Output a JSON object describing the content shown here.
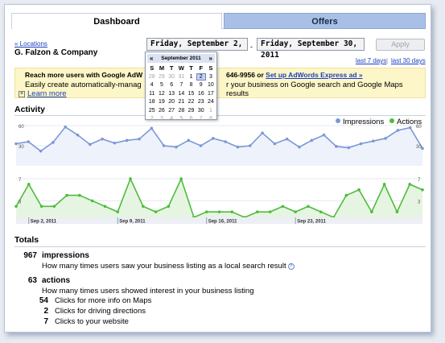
{
  "tabs": [
    {
      "label": "Dashboard"
    },
    {
      "label": "Offers"
    }
  ],
  "header": {
    "back_link": "« Locations",
    "company": "G. Falzon & Company"
  },
  "date_range": {
    "start": "Friday, September 2, 2011",
    "separator": "-",
    "end": "Friday, September 30, 2011",
    "apply_label": "Apply",
    "quick_links": [
      "last 7 days",
      "last 30 days"
    ],
    "quick_sep": "|"
  },
  "calendar": {
    "month": "September 2011",
    "prev": "«",
    "next": "»",
    "weekdays": [
      "S",
      "M",
      "T",
      "W",
      "T",
      "F",
      "S"
    ],
    "weeks": [
      [
        "28",
        "29",
        "30",
        "31",
        "1",
        "2",
        "3"
      ],
      [
        "4",
        "5",
        "6",
        "7",
        "8",
        "9",
        "10"
      ],
      [
        "11",
        "12",
        "13",
        "14",
        "15",
        "16",
        "17"
      ],
      [
        "18",
        "19",
        "20",
        "21",
        "22",
        "23",
        "24"
      ],
      [
        "25",
        "26",
        "27",
        "28",
        "29",
        "30",
        "1"
      ],
      [
        "2",
        "3",
        "4",
        "5",
        "6",
        "7",
        "8"
      ]
    ],
    "selected": "2"
  },
  "banner": {
    "line1_left": "Reach more users with Google AdW",
    "line1_right": "646-9956 or ",
    "line1_link": "Set up AdWords Express ad »",
    "line2_left": "Easily create automatically-manag",
    "line2_right": "r your business on Google search and Google Maps results",
    "learn_more": "Learn more",
    "plus": "+"
  },
  "activity": {
    "title": "Activity",
    "legend": [
      {
        "name": "Impressions",
        "color": "#7b98d6"
      },
      {
        "name": "Actions",
        "color": "#4fbb3c"
      }
    ]
  },
  "chart_data": [
    {
      "type": "line",
      "series": [
        {
          "name": "Impressions",
          "values": [
            33,
            36,
            22,
            35,
            58,
            46,
            32,
            40,
            34,
            38,
            40,
            56,
            30,
            28,
            38,
            30,
            41,
            36,
            28,
            30,
            49,
            33,
            40,
            28,
            38,
            46,
            29,
            27,
            33,
            37,
            41,
            53,
            57,
            26
          ]
        }
      ],
      "y_ticks": [
        "60",
        "30"
      ],
      "ylim": [
        0,
        60
      ]
    },
    {
      "type": "area",
      "series": [
        {
          "name": "Actions",
          "values": [
            2,
            6,
            2,
            2,
            4,
            4,
            3,
            2,
            1,
            7,
            2,
            1,
            2,
            7,
            0,
            1,
            1,
            1,
            0,
            1,
            1,
            2,
            1,
            2,
            1,
            0,
            4,
            5,
            1,
            6,
            1,
            6,
            5
          ]
        }
      ],
      "y_ticks": [
        "7",
        "3"
      ],
      "ylim": [
        0,
        7
      ],
      "x_labels": [
        "Sep 2, 2011",
        "Sep 9, 2011",
        "Sep 16, 2011",
        "Sep 23, 2011"
      ]
    }
  ],
  "totals": {
    "title": "Totals",
    "impressions": {
      "value": "967",
      "label": "impressions",
      "desc": "How many times users saw your business listing as a local search result",
      "help": "?"
    },
    "actions": {
      "value": "63",
      "label": "actions",
      "desc": "How many times users showed interest in your business listing"
    },
    "breakdown": [
      {
        "value": "54",
        "label": "Clicks for more info on Maps"
      },
      {
        "value": "2",
        "label": "Clicks for driving directions"
      },
      {
        "value": "7",
        "label": "Clicks to your website"
      }
    ]
  }
}
